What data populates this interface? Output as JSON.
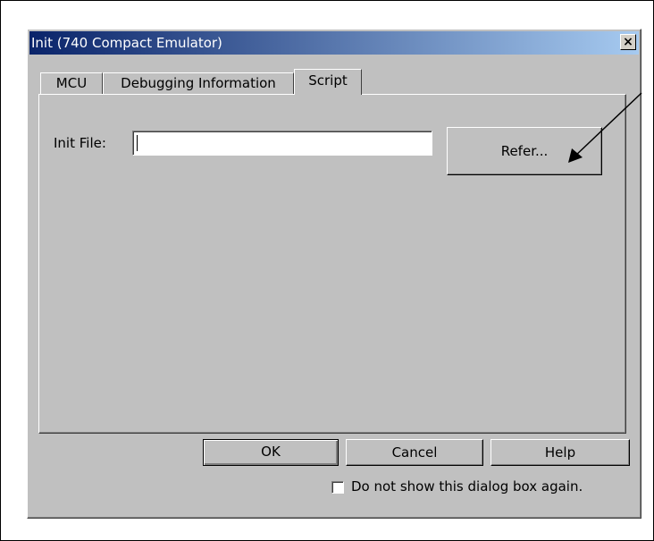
{
  "window": {
    "title": "Init (740 Compact Emulator)",
    "close_glyph": "×"
  },
  "tabs": [
    {
      "label": "MCU",
      "active": false
    },
    {
      "label": "Debugging Information",
      "active": false
    },
    {
      "label": "Script",
      "active": true
    }
  ],
  "script_tab": {
    "init_file_label": "Init File:",
    "init_file_value": "",
    "refer_button_label": "Refer..."
  },
  "footer": {
    "ok_label": "OK",
    "cancel_label": "Cancel",
    "help_label": "Help",
    "dont_show_again_label": "Do not show this dialog box again.",
    "dont_show_again_checked": false
  },
  "colors": {
    "dialog_face": "#c0c0c0",
    "title_gradient_start": "#0a246a",
    "title_gradient_end": "#a6caf0",
    "title_text": "#ffffff"
  },
  "icons": {
    "close": "close-icon",
    "annotation": "arrow-pointer-icon"
  }
}
